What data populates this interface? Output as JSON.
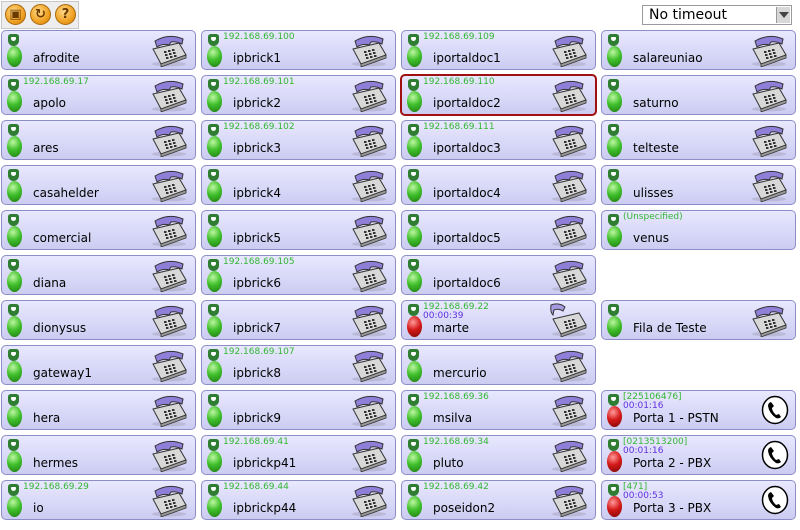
{
  "toolbar": {
    "buttons": [
      {
        "name": "lock-icon",
        "glyph": "▣"
      },
      {
        "name": "refresh-icon",
        "glyph": "↻"
      },
      {
        "name": "help-icon",
        "glyph": "?"
      }
    ],
    "timeout_select": {
      "value": "No timeout"
    }
  },
  "colors": {
    "ip": "#33b533",
    "timer": "#6030e0",
    "selected_border": "#a01010"
  },
  "columns": [
    [
      {
        "name": "afrodite",
        "ip": "",
        "timer": "",
        "status": "green",
        "device": "phone"
      },
      {
        "name": "apolo",
        "ip": "192.168.69.17",
        "timer": "",
        "status": "green",
        "device": "phone"
      },
      {
        "name": "ares",
        "ip": "",
        "timer": "",
        "status": "green",
        "device": "phone"
      },
      {
        "name": "casahelder",
        "ip": "",
        "timer": "",
        "status": "green",
        "device": "phone"
      },
      {
        "name": "comercial",
        "ip": "",
        "timer": "",
        "status": "green",
        "device": "phone"
      },
      {
        "name": "diana",
        "ip": "",
        "timer": "",
        "status": "green",
        "device": "phone"
      },
      {
        "name": "dionysus",
        "ip": "",
        "timer": "",
        "status": "green",
        "device": "phone"
      },
      {
        "name": "gateway1",
        "ip": "",
        "timer": "",
        "status": "green",
        "device": "phone"
      },
      {
        "name": "hera",
        "ip": "",
        "timer": "",
        "status": "green",
        "device": "phone"
      },
      {
        "name": "hermes",
        "ip": "",
        "timer": "",
        "status": "green",
        "device": "phone"
      },
      {
        "name": "io",
        "ip": "192.168.69.29",
        "timer": "",
        "status": "green",
        "device": "phone"
      }
    ],
    [
      {
        "name": "ipbrick1",
        "ip": "192.168.69.100",
        "timer": "",
        "status": "green",
        "device": "phone"
      },
      {
        "name": "ipbrick2",
        "ip": "192.168.69.101",
        "timer": "",
        "status": "green",
        "device": "phone"
      },
      {
        "name": "ipbrick3",
        "ip": "192.168.69.102",
        "timer": "",
        "status": "green",
        "device": "phone"
      },
      {
        "name": "ipbrick4",
        "ip": "",
        "timer": "",
        "status": "green",
        "device": "phone"
      },
      {
        "name": "ipbrick5",
        "ip": "",
        "timer": "",
        "status": "green",
        "device": "phone"
      },
      {
        "name": "ipbrick6",
        "ip": "192.168.69.105",
        "timer": "",
        "status": "green",
        "device": "phone"
      },
      {
        "name": "ipbrick7",
        "ip": "",
        "timer": "",
        "status": "green",
        "device": "phone"
      },
      {
        "name": "ipbrick8",
        "ip": "192.168.69.107",
        "timer": "",
        "status": "green",
        "device": "phone"
      },
      {
        "name": "ipbrick9",
        "ip": "",
        "timer": "",
        "status": "green",
        "device": "phone"
      },
      {
        "name": "ipbrickp41",
        "ip": "192.168.69.41",
        "timer": "",
        "status": "green",
        "device": "phone"
      },
      {
        "name": "ipbrickp44",
        "ip": "192.168.69.44",
        "timer": "",
        "status": "green",
        "device": "phone"
      }
    ],
    [
      {
        "name": "iportaldoc1",
        "ip": "192.168.69.109",
        "timer": "",
        "status": "green",
        "device": "phone"
      },
      {
        "name": "iportaldoc2",
        "ip": "192.168.69.110",
        "timer": "",
        "status": "green",
        "device": "phone",
        "selected": true
      },
      {
        "name": "iportaldoc3",
        "ip": "192.168.69.111",
        "timer": "",
        "status": "green",
        "device": "phone"
      },
      {
        "name": "iportaldoc4",
        "ip": "",
        "timer": "",
        "status": "green",
        "device": "phone"
      },
      {
        "name": "iportaldoc5",
        "ip": "",
        "timer": "",
        "status": "green",
        "device": "phone"
      },
      {
        "name": "iportaldoc6",
        "ip": "",
        "timer": "",
        "status": "green",
        "device": "phone"
      },
      {
        "name": "marte",
        "ip": "192.168.69.22",
        "timer": "00:00:39",
        "status": "red",
        "device": "phone-offhook"
      },
      {
        "name": "mercurio",
        "ip": "",
        "timer": "",
        "status": "green",
        "device": "phone"
      },
      {
        "name": "msilva",
        "ip": "192.168.69.36",
        "timer": "",
        "status": "green",
        "device": "phone"
      },
      {
        "name": "pluto",
        "ip": "192.168.69.34",
        "timer": "",
        "status": "green",
        "device": "phone"
      },
      {
        "name": "poseidon2",
        "ip": "192.168.69.42",
        "timer": "",
        "status": "green",
        "device": "phone"
      }
    ],
    [
      {
        "name": "salareuniao",
        "ip": "",
        "timer": "",
        "status": "green",
        "device": "phone"
      },
      {
        "name": "saturno",
        "ip": "",
        "timer": "",
        "status": "green",
        "device": "phone"
      },
      {
        "name": "telteste",
        "ip": "",
        "timer": "",
        "status": "green",
        "device": "phone"
      },
      {
        "name": "ulisses",
        "ip": "",
        "timer": "",
        "status": "green",
        "device": "phone"
      },
      {
        "name": "venus",
        "ip": "(Unspecified)",
        "timer": "",
        "status": "green",
        "device": "none"
      },
      null,
      {
        "name": "Fila de Teste",
        "ip": "",
        "timer": "",
        "status": "green",
        "device": "phone"
      },
      null,
      {
        "name": "Porta 1 - PSTN",
        "ip": "[225106476]",
        "timer": "00:01:16",
        "status": "red",
        "device": "handset"
      },
      {
        "name": "Porta 2 - PBX",
        "ip": "[0213513200]",
        "timer": "00:01:16",
        "status": "red",
        "device": "handset"
      },
      {
        "name": "Porta 3 - PBX",
        "ip": "[471]",
        "timer": "00:00:53",
        "status": "red",
        "device": "handset"
      }
    ]
  ]
}
